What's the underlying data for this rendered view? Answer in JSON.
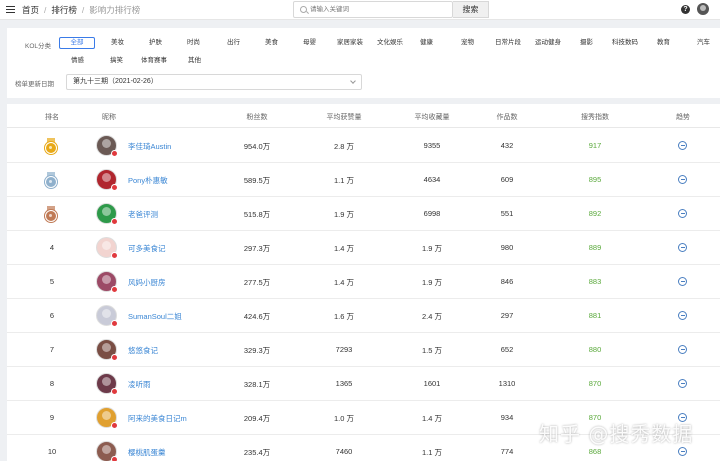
{
  "topbar": {
    "breadcrumbs": [
      "首页",
      "排行榜",
      "影响力排行榜"
    ],
    "search_placeholder": "请输入关键词",
    "search_button": "搜索",
    "help_glyph": "?"
  },
  "filter": {
    "category_label": "KOL分类",
    "categories_row1": [
      "全部",
      "美妆",
      "护肤",
      "时尚",
      "出行",
      "美食",
      "母婴",
      "家居家装",
      "文化娱乐",
      "健康",
      "宠物",
      "日常片段",
      "运动健身",
      "摄影",
      "科技数码",
      "教育",
      "汽车"
    ],
    "categories_row2": [
      "情感",
      "搞笑",
      "体育赛事",
      "其他"
    ],
    "active_category": "全部",
    "period_label": "榜单更新日期",
    "period_value": "第九十三期（2021-02-26）"
  },
  "table": {
    "headers": [
      "排名",
      "昵称",
      "粉丝数",
      "平均获赞量",
      "平均收藏量",
      "作品数",
      "搜秀指数",
      "趋势"
    ],
    "rows": [
      {
        "rank": "",
        "medal": "gold",
        "name": "李佳琦Austin",
        "fans": "954.0万",
        "avg_likes": "2.8 万",
        "avg_fav": "9355",
        "works": "432",
        "score": "917",
        "avatar_color": "#6b5a55"
      },
      {
        "rank": "",
        "medal": "silver",
        "name": "Pony朴惠敏",
        "fans": "589.5万",
        "avg_likes": "1.1 万",
        "avg_fav": "4634",
        "works": "609",
        "score": "895",
        "avatar_color": "#b0262e"
      },
      {
        "rank": "",
        "medal": "bronze",
        "name": "老爸评测",
        "fans": "515.8万",
        "avg_likes": "1.9 万",
        "avg_fav": "6998",
        "works": "551",
        "score": "892",
        "avatar_color": "#2e9a4a"
      },
      {
        "rank": "4",
        "medal": "",
        "name": "可多美食记",
        "fans": "297.3万",
        "avg_likes": "1.4 万",
        "avg_fav": "1.9 万",
        "works": "980",
        "score": "889",
        "avatar_color": "#f2d4d0"
      },
      {
        "rank": "5",
        "medal": "",
        "name": "风妈小厨房",
        "fans": "277.5万",
        "avg_likes": "1.4 万",
        "avg_fav": "1.9 万",
        "works": "846",
        "score": "883",
        "avatar_color": "#9c4a66"
      },
      {
        "rank": "6",
        "medal": "",
        "name": "SumanSoul二姐",
        "fans": "424.6万",
        "avg_likes": "1.6 万",
        "avg_fav": "2.4 万",
        "works": "297",
        "score": "881",
        "avatar_color": "#c9cbd8"
      },
      {
        "rank": "7",
        "medal": "",
        "name": "悠悠食记",
        "fans": "329.3万",
        "avg_likes": "7293",
        "avg_fav": "1.5 万",
        "works": "652",
        "score": "880",
        "avatar_color": "#7a4e44"
      },
      {
        "rank": "8",
        "medal": "",
        "name": "凌听雨",
        "fans": "328.1万",
        "avg_likes": "1365",
        "avg_fav": "1601",
        "works": "1310",
        "score": "870",
        "avatar_color": "#6d3a4a"
      },
      {
        "rank": "9",
        "medal": "",
        "name": "阿来的美食日记m",
        "fans": "209.4万",
        "avg_likes": "1.0 万",
        "avg_fav": "1.4 万",
        "works": "934",
        "score": "870",
        "avatar_color": "#e0a030"
      },
      {
        "rank": "10",
        "medal": "",
        "name": "樱桃肌蛋羹",
        "fans": "235.4万",
        "avg_likes": "7460",
        "avg_fav": "1.1 万",
        "works": "774",
        "score": "868",
        "avatar_color": "#8c5c50"
      }
    ]
  },
  "watermark": "知乎 @搜秀数据",
  "colors": {
    "accent": "#3a7be8",
    "score": "#5aa93b",
    "link": "#3a86d4",
    "gold": "#e8a917",
    "silver": "#8fb0cc",
    "bronze": "#c07a55",
    "badge": "#e0393e"
  }
}
